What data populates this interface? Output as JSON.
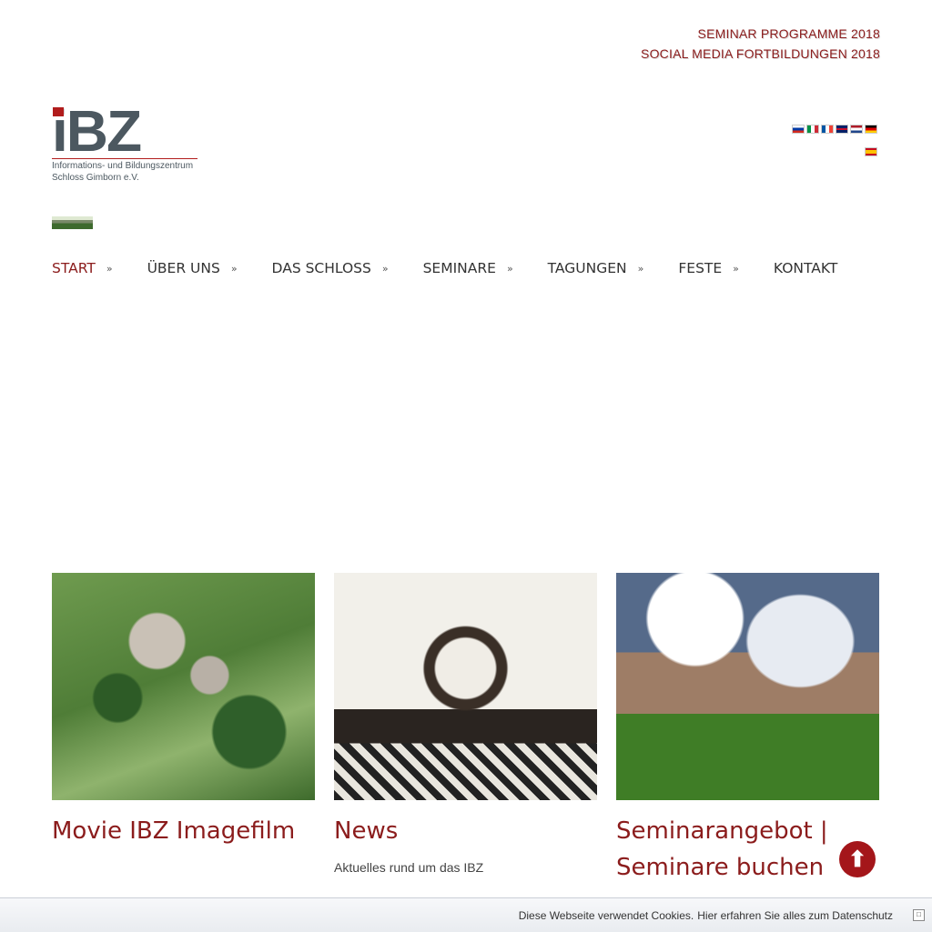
{
  "top_links": {
    "seminar_programme": "SEMINAR PROGRAMME 2018",
    "social_media": "SOCIAL MEDIA FORTBILDUNGEN 2018"
  },
  "logo": {
    "mark": "iBZ",
    "line1": "Informations- und Bildungszentrum",
    "line2": "Schloss Gimborn e.V."
  },
  "flags": [
    "russian-flag",
    "italian-flag",
    "french-flag",
    "british-flag",
    "dutch-flag",
    "german-flag",
    "spanish-flag"
  ],
  "nav": [
    {
      "label": "START",
      "active": true
    },
    {
      "label": "ÜBER UNS"
    },
    {
      "label": "DAS SCHLOSS"
    },
    {
      "label": "SEMINARE"
    },
    {
      "label": "TAGUNGEN"
    },
    {
      "label": "FESTE"
    },
    {
      "label": "KONTAKT"
    }
  ],
  "nav_arrow": "»",
  "cards": [
    {
      "title": "Movie IBZ Imagefilm",
      "text": ""
    },
    {
      "title": "News",
      "text": "Aktuelles rund um das IBZ"
    },
    {
      "title": "Seminarangebot | Seminare buchen",
      "text": ""
    }
  ],
  "cookie_bar": {
    "text": "Diese Webseite verwendet Cookies.",
    "link": "Hier erfahren Sie alles zum Datenschutz",
    "close": "□"
  },
  "colors": {
    "accent": "#8b1c1c",
    "logo_gray": "#4c5860",
    "to_top_button": "#a4161a"
  }
}
